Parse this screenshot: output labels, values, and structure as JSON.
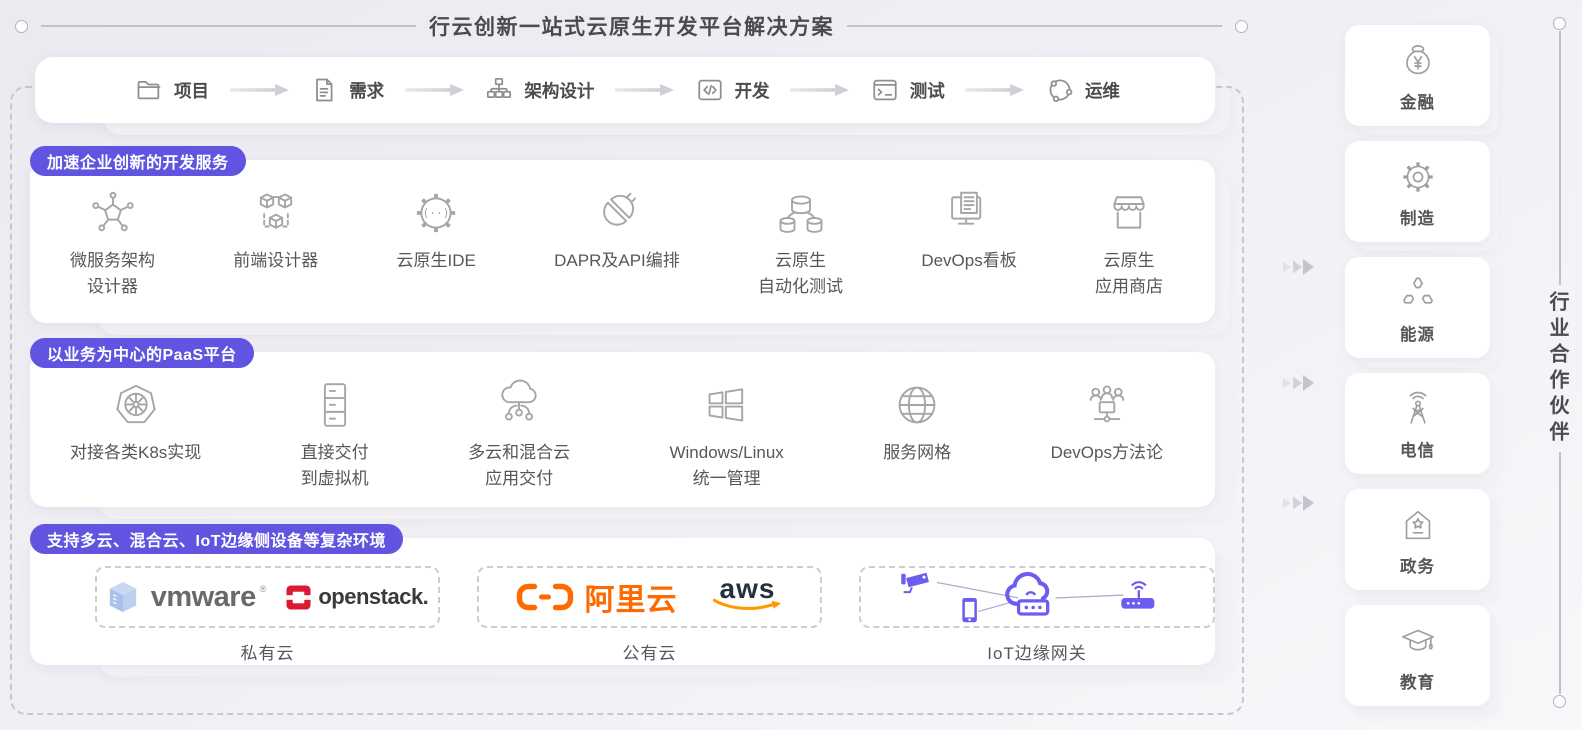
{
  "title": "行云创新一站式云原生开发平台解决方案",
  "workflow": [
    {
      "label": "项目",
      "icon": "folder-icon"
    },
    {
      "label": "需求",
      "icon": "requirement-doc-icon"
    },
    {
      "label": "架构设计",
      "icon": "architecture-icon"
    },
    {
      "label": "开发",
      "icon": "code-window-icon"
    },
    {
      "label": "测试",
      "icon": "terminal-icon"
    },
    {
      "label": "运维",
      "icon": "operations-icon"
    }
  ],
  "sections": [
    {
      "badge": "加速企业创新的开发服务",
      "items": [
        {
          "label": "微服务架构\n设计器",
          "icon": "microservice-designer-icon"
        },
        {
          "label": "前端设计器",
          "icon": "frontend-designer-icon"
        },
        {
          "label": "云原生IDE",
          "icon": "cloud-ide-icon"
        },
        {
          "label": "DAPR及API编排",
          "icon": "api-orchestration-icon"
        },
        {
          "label": "云原生\n自动化测试",
          "icon": "automated-testing-icon"
        },
        {
          "label": "DevOps看板",
          "icon": "devops-board-icon"
        },
        {
          "label": "云原生\n应用商店",
          "icon": "app-store-icon"
        }
      ]
    },
    {
      "badge": "以业务为中心的PaaS平台",
      "items": [
        {
          "label": "对接各类K8s实现",
          "icon": "k8s-icon"
        },
        {
          "label": "直接交付\n到虚拟机",
          "icon": "vm-delivery-icon"
        },
        {
          "label": "多云和混合云\n应用交付",
          "icon": "multicloud-delivery-icon"
        },
        {
          "label": "Windows/Linux\n统一管理",
          "icon": "windows-linux-icon"
        },
        {
          "label": "服务网格",
          "icon": "service-mesh-icon"
        },
        {
          "label": "DevOps方法论",
          "icon": "devops-methodology-icon"
        }
      ]
    }
  ],
  "environments": {
    "badge": "支持多云、混合云、IoT边缘侧设备等复杂环境",
    "groups": [
      {
        "label": "私有云",
        "logos": [
          {
            "name": "vmware-logo",
            "text": "vmware",
            "mark": "®"
          },
          {
            "name": "openstack-logo",
            "text": "openstack."
          }
        ]
      },
      {
        "label": "公有云",
        "logos": [
          {
            "name": "alibaba-cloud-logo",
            "text": "阿里云"
          },
          {
            "name": "aws-logo",
            "text": "aws"
          }
        ]
      },
      {
        "label": "IoT边缘网关",
        "logos": [
          {
            "name": "iot-devices-graphic"
          }
        ]
      }
    ]
  },
  "partners": {
    "title": "行业合作伙伴",
    "items": [
      {
        "label": "金融",
        "icon": "finance-icon"
      },
      {
        "label": "制造",
        "icon": "manufacturing-icon"
      },
      {
        "label": "能源",
        "icon": "energy-icon"
      },
      {
        "label": "电信",
        "icon": "telecom-icon"
      },
      {
        "label": "政务",
        "icon": "government-icon"
      },
      {
        "label": "教育",
        "icon": "education-icon"
      }
    ]
  },
  "colors": {
    "badge_purple": "#6154E0",
    "iot_purple": "#6C5CF0",
    "openstack_red": "#DA1A32",
    "alibaba_orange": "#FF6A00",
    "aws_navy": "#252F3E",
    "aws_orange": "#FF9900",
    "vmware_gray": "#6B686D"
  }
}
